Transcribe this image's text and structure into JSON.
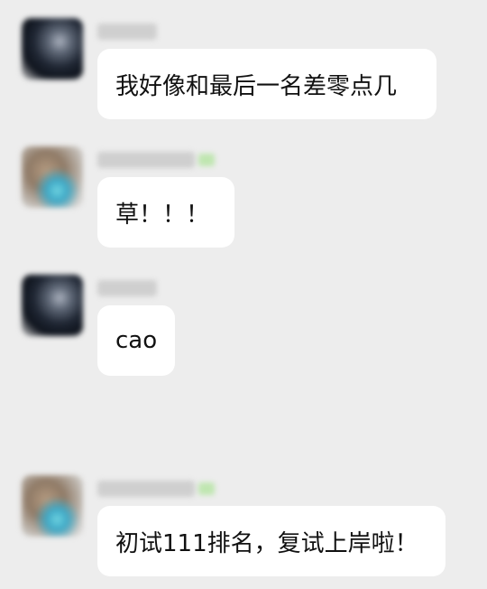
{
  "messages": [
    {
      "avatar": "dark-avatar",
      "text": "我好像和最后一名差零点几"
    },
    {
      "avatar": "photo-avatar",
      "text": "草！！！"
    },
    {
      "avatar": "dark-avatar",
      "text": "cao"
    },
    {
      "avatar": "photo-avatar",
      "text": "初试111排名，复试上岸啦！"
    }
  ]
}
